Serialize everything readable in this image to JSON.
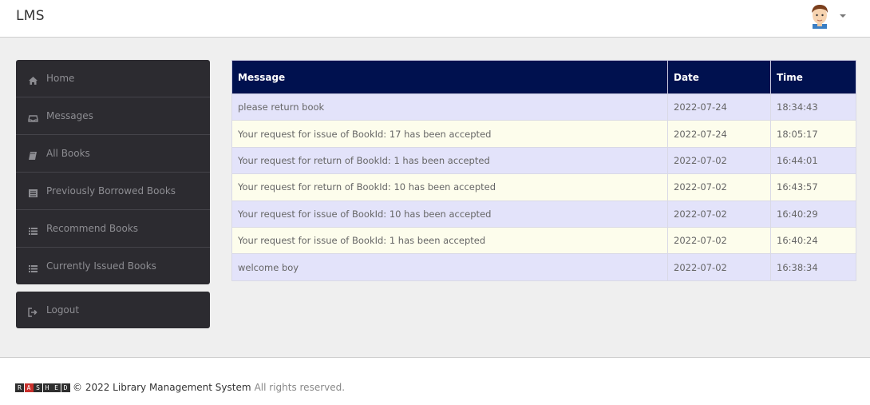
{
  "header": {
    "brand": "LMS",
    "avatar_icon": "user-avatar",
    "menu_icon": "caret-down-icon"
  },
  "sidebar": {
    "items": [
      {
        "label": "Home",
        "icon": "home-icon"
      },
      {
        "label": "Messages",
        "icon": "inbox-icon"
      },
      {
        "label": "All Books",
        "icon": "book-icon"
      },
      {
        "label": "Previously Borrowed Books",
        "icon": "list-alt-icon"
      },
      {
        "label": "Recommend Books",
        "icon": "list-icon"
      },
      {
        "label": "Currently Issued Books",
        "icon": "list-icon"
      }
    ],
    "logout": {
      "label": "Logout",
      "icon": "logout-icon"
    }
  },
  "messages_table": {
    "columns": [
      "Message",
      "Date",
      "Time"
    ],
    "rows": [
      {
        "message": "please return book",
        "date": "2022-07-24",
        "time": "18:34:43"
      },
      {
        "message": "Your request for issue of BookId: 17 has been accepted",
        "date": "2022-07-24",
        "time": "18:05:17"
      },
      {
        "message": "Your request for return of BookId: 1 has been accepted",
        "date": "2022-07-02",
        "time": "16:44:01"
      },
      {
        "message": "Your request for return of BookId: 10 has been accepted",
        "date": "2022-07-02",
        "time": "16:43:57"
      },
      {
        "message": "Your request for issue of BookId: 10 has been accepted",
        "date": "2022-07-02",
        "time": "16:40:29"
      },
      {
        "message": "Your request for issue of BookId: 1 has been accepted",
        "date": "2022-07-02",
        "time": "16:40:24"
      },
      {
        "message": "welcome boy",
        "date": "2022-07-02",
        "time": "16:38:34"
      }
    ]
  },
  "footer": {
    "logo_letters": [
      "R",
      "A",
      "S",
      "H",
      "E",
      "D"
    ],
    "copyright": "© 2022 Library Management System",
    "rights": "All rights reserved."
  },
  "colors": {
    "table_header_bg": "#00114f",
    "row_odd_bg": "#e3e3fa",
    "row_even_bg": "#fdfdec",
    "sidebar_bg": "#2c2b30"
  }
}
